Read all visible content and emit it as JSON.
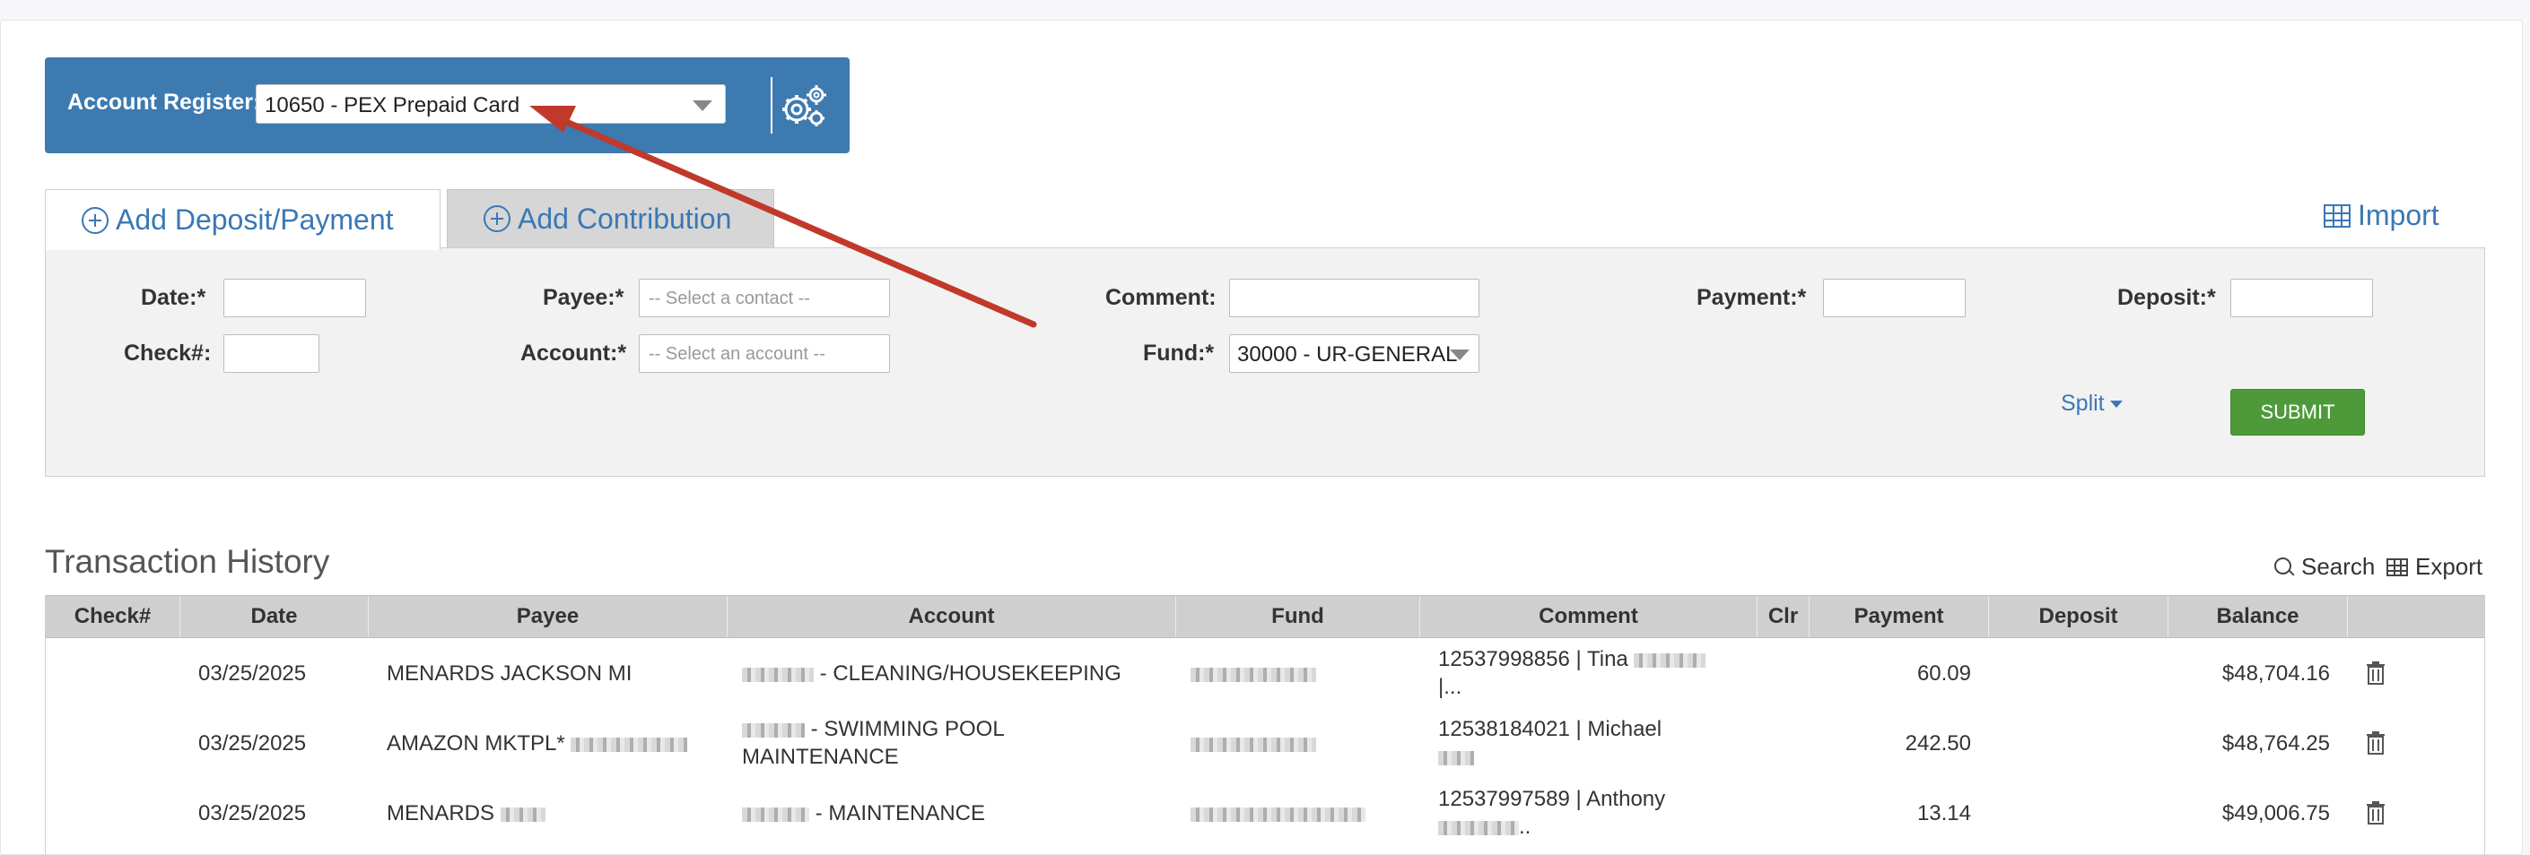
{
  "register": {
    "label": "Account Register:",
    "selected": "10650 - PEX Prepaid Card"
  },
  "tabs": [
    {
      "label": "Add Deposit/Payment",
      "active": true
    },
    {
      "label": "Add Contribution",
      "active": false
    }
  ],
  "import_label": "Import",
  "form": {
    "date_label": "Date:*",
    "check_label": "Check#:",
    "payee_label": "Payee:*",
    "payee_placeholder": "-- Select a contact --",
    "account_label": "Account:*",
    "account_placeholder": "-- Select an account --",
    "comment_label": "Comment:",
    "fund_label": "Fund:*",
    "fund_value": "30000 - UR-GENERAL",
    "payment_label": "Payment:*",
    "deposit_label": "Deposit:*",
    "split_label": "Split",
    "submit_label": "SUBMIT"
  },
  "history": {
    "title": "Transaction History",
    "search_label": "Search",
    "export_label": "Export",
    "columns": [
      "Check#",
      "Date",
      "Payee",
      "Account",
      "Fund",
      "Comment",
      "Clr",
      "Payment",
      "Deposit",
      "Balance"
    ],
    "rows": [
      {
        "check": "",
        "date": "03/25/2025",
        "payee": "MENARDS JACKSON MI",
        "account": "- CLEANING/HOUSEKEEPING",
        "comment_l1": "12537998856 | Tina",
        "comment_l2": "|...",
        "clr": "",
        "payment": "60.09",
        "deposit": "",
        "balance": "$48,704.16"
      },
      {
        "check": "",
        "date": "03/25/2025",
        "payee": "AMAZON MKTPL*",
        "account_l1": "- SWIMMING POOL",
        "account_l2": "MAINTENANCE",
        "comment_l1": "12538184021 | Michael",
        "comment_l2": "",
        "clr": "",
        "payment": "242.50",
        "deposit": "",
        "balance": "$48,764.25"
      },
      {
        "check": "",
        "date": "03/25/2025",
        "payee": "MENARDS",
        "account": "- MAINTENANCE",
        "comment_l1": "12537997589 | Anthony",
        "comment_l2": "..",
        "clr": "",
        "payment": "13.14",
        "deposit": "",
        "balance": "$49,006.75"
      }
    ]
  },
  "colors": {
    "register_bar": "#3d7ab0",
    "link": "#3a78b5",
    "submit": "#4e9a3b",
    "annotation_arrow": "#c0392b"
  }
}
